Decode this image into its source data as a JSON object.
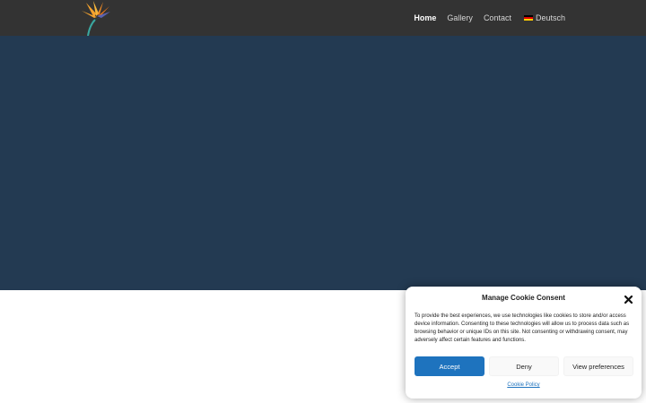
{
  "nav": {
    "items": [
      {
        "label": "Home",
        "active": true
      },
      {
        "label": "Gallery",
        "active": false
      },
      {
        "label": "Contact",
        "active": false
      }
    ],
    "language": {
      "label": "Deutsch",
      "flag_icon": "german-flag-icon"
    }
  },
  "logo": {
    "icon": "bird-of-paradise-flower-icon"
  },
  "colors": {
    "header_bg": "#333333",
    "hero_bg": "#233a52",
    "accent": "#1e73be"
  },
  "cookie_banner": {
    "title": "Manage Cookie Consent",
    "body": "To provide the best experiences, we use technologies like cookies to store and/or access device information. Consenting to these technologies will allow us to process data such as browsing behavior or unique IDs on this site. Not consenting or withdrawing consent, may adversely affect certain features and functions.",
    "accept_label": "Accept",
    "deny_label": "Deny",
    "preferences_label": "View preferences",
    "policy_link": "Cookie Policy"
  }
}
